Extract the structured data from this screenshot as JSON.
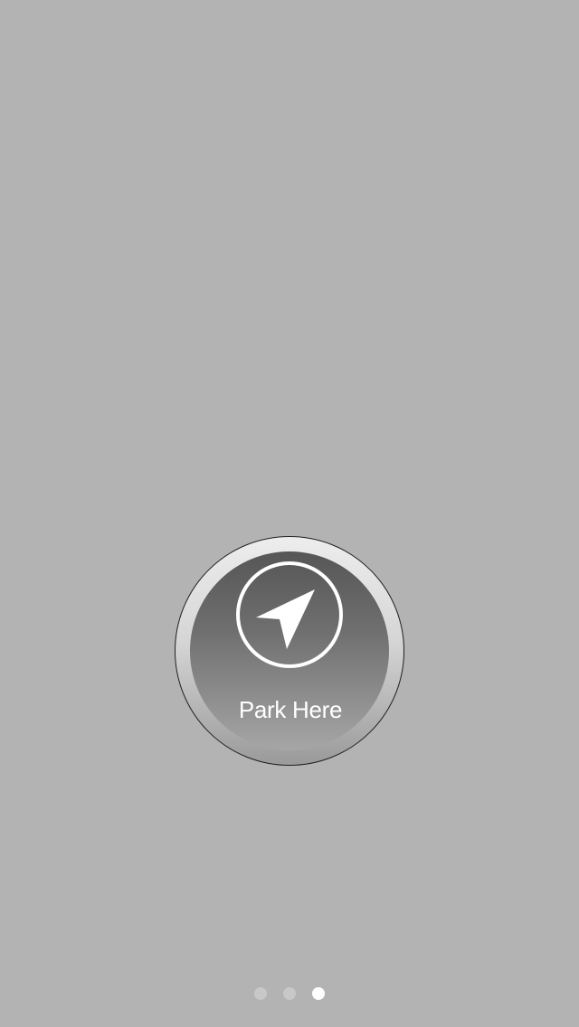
{
  "park_button": {
    "label": "Park Here",
    "icon": "navigation-arrow-icon"
  },
  "page_control": {
    "page_count": 3,
    "current_page": 3
  },
  "colors": {
    "background": "#b3b3b3",
    "button_text": "#ffffff",
    "active_dot": "#ffffff",
    "inactive_dot": "#c8c8c8"
  }
}
